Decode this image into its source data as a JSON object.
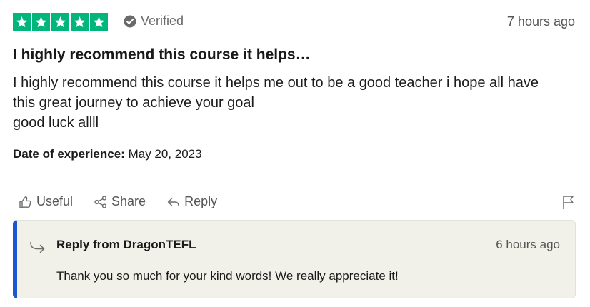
{
  "review": {
    "rating": 5,
    "rating_max": 5,
    "star_color": "#00b67a",
    "verified_label": "Verified",
    "time_ago": "7 hours ago",
    "title": "I highly recommend this course it helps…",
    "body_lines": [
      "I highly recommend this course it helps me out to be a good teacher i hope all have",
      "this great journey to achieve your goal",
      "good luck allll"
    ],
    "experience_label": "Date of experience:",
    "experience_date": "May 20, 2023"
  },
  "actions": {
    "useful_label": "Useful",
    "share_label": "Share",
    "reply_label": "Reply",
    "flag_icon": "flag-icon"
  },
  "reply": {
    "from": "Reply from DragonTEFL",
    "time_ago": "6 hours ago",
    "text": "Thank you so much for your kind words! We really appreciate it!",
    "accent_color": "#1e56cf",
    "background_color": "#f1f0e9"
  }
}
